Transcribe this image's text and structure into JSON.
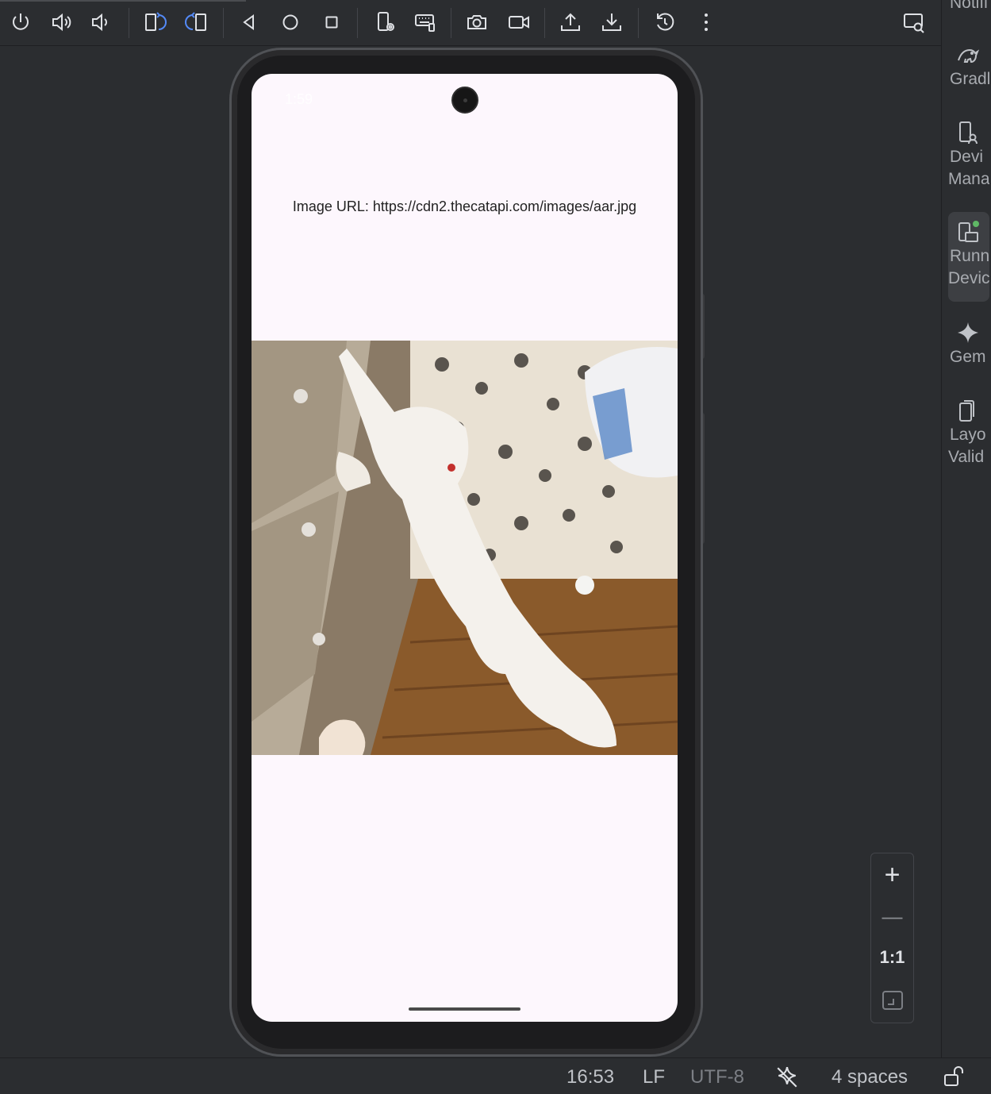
{
  "toolbar": {
    "buttons": [
      {
        "icon": "power-icon"
      },
      {
        "icon": "volume-up-icon"
      },
      {
        "icon": "volume-down-icon"
      },
      {
        "icon": "rotate-left-icon"
      },
      {
        "icon": "rotate-right-icon"
      },
      {
        "icon": "back-icon"
      },
      {
        "icon": "home-icon"
      },
      {
        "icon": "overview-icon"
      },
      {
        "icon": "device-settings-icon"
      },
      {
        "icon": "keyboard-icon"
      },
      {
        "icon": "camera-icon"
      },
      {
        "icon": "video-icon"
      },
      {
        "icon": "upload-icon"
      },
      {
        "icon": "download-icon"
      },
      {
        "icon": "reset-icon"
      },
      {
        "icon": "more-icon"
      },
      {
        "icon": "window-search-icon"
      }
    ]
  },
  "tool_windows": [
    {
      "label": "Notifi",
      "icon": "bell-icon"
    },
    {
      "label": "Gradl",
      "icon": "gradle-icon"
    },
    {
      "label": "Devi\nMana",
      "icon": "device-manager-icon"
    },
    {
      "label": "Runn\nDevic",
      "icon": "running-devices-icon",
      "active": true
    },
    {
      "label": "Gem",
      "icon": "gemini-icon"
    },
    {
      "label": "Layo\nValid",
      "icon": "layout-validation-icon"
    }
  ],
  "device": {
    "status_time": "1:59",
    "url_text": "Image URL: https://cdn2.thecatapi.com/images/aar.jpg"
  },
  "zoom": {
    "zoom_in": "+",
    "zoom_out": "—",
    "ratio": "1:1"
  },
  "status_bar": {
    "time": "16:53",
    "line_ending": "LF",
    "encoding": "UTF-8",
    "indent": "4 spaces"
  },
  "colors": {
    "ide_background": "#2b2d30",
    "screen_background": "#fdf7fd",
    "accent_blue": "#548af7",
    "active_green": "#5fb865"
  }
}
